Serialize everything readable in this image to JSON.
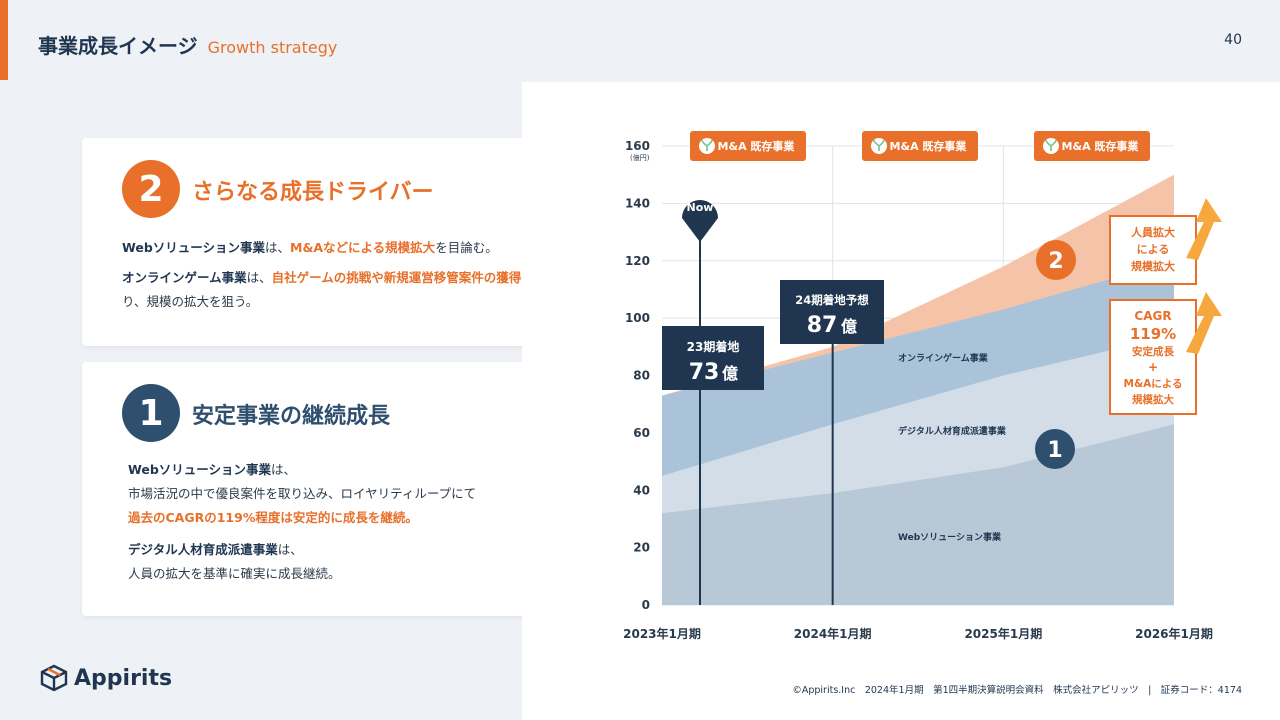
{
  "header": {
    "title": "事業成長イメージ",
    "subtitle": "Growth strategy",
    "page_number": "40"
  },
  "card_growth": {
    "badge": "2",
    "heading": "さらなる成長ドライバー",
    "p1_bold": "Webソリューション事業",
    "p1_mid": "は、",
    "p1_hl": "M&Aなどによる規模拡大",
    "p1_end": "を目論む。",
    "p2_bold": "オンラインゲーム事業",
    "p2_mid": "は、",
    "p2_hl": "自社ゲームの挑戦や新規運営移管案件の獲得",
    "p2_end": "等により、規模の拡大を狙う。"
  },
  "card_stable": {
    "badge": "1",
    "heading": "安定事業の継続成長",
    "p1_bold": "Webソリューション事業",
    "p1_mid": "は、",
    "p1_line2": "市場活況の中で優良案件を取り込み、ロイヤリティループにて",
    "p1_hl": "過去のCAGRの119%程度は安定的に成長を継続。",
    "p2_bold": "デジタル人材育成派遣事業",
    "p2_mid": "は、",
    "p2_line2": "人員の拡大を基準に確実に成長継続。"
  },
  "chart_data": {
    "type": "area",
    "x": [
      "2023年1月期",
      "2024年1月期",
      "2025年1月期",
      "2026年1月期"
    ],
    "ylim": [
      0,
      160
    ],
    "yticks": [
      0,
      20,
      40,
      60,
      80,
      100,
      120,
      140,
      160
    ],
    "yunit": "(億円)",
    "series": [
      {
        "name": "Webソリューション事業",
        "values": [
          32,
          39,
          48,
          63
        ],
        "color": "#b9c8d6"
      },
      {
        "name": "デジタル人材育成派遣事業",
        "values": [
          45,
          63,
          80,
          94
        ],
        "color": "#d2dde8"
      },
      {
        "name": "オンラインゲーム事業",
        "values": [
          73,
          88,
          103,
          120
        ],
        "color": "#aac3d9"
      },
      {
        "name": "",
        "values": [
          73,
          90,
          118,
          150
        ],
        "color": "#f5c4a8"
      }
    ],
    "series_labels": [
      "Webソリューション事業",
      "デジタル人材育成派遣事業",
      "オンラインゲーム事業"
    ],
    "ma_labels": [
      "M&A 既存事業",
      "M&A 既存事業",
      "M&A 既存事業"
    ],
    "now_pin": "Now",
    "callout_23": {
      "label": "23期着地",
      "value": "73",
      "unit": "億"
    },
    "callout_24": {
      "label": "24期着地予想",
      "value": "87",
      "unit": "億"
    },
    "side_box_1": [
      "人員拡大",
      "による",
      "規模拡大"
    ],
    "side_box_2": [
      "CAGR",
      "119%",
      "安定成長",
      "+",
      "M&Aによる",
      "規模拡大"
    ],
    "marker_2": "2",
    "marker_1": "1"
  },
  "logo": {
    "text": "Appirits"
  },
  "footer": {
    "text": "©Appirits.Inc　2024年1月期　第1四半期決算説明会資料　株式会社アピリッツ　|　証券コード：4174"
  },
  "colors": {
    "accent": "#e8702a",
    "navy": "#1f3550"
  }
}
